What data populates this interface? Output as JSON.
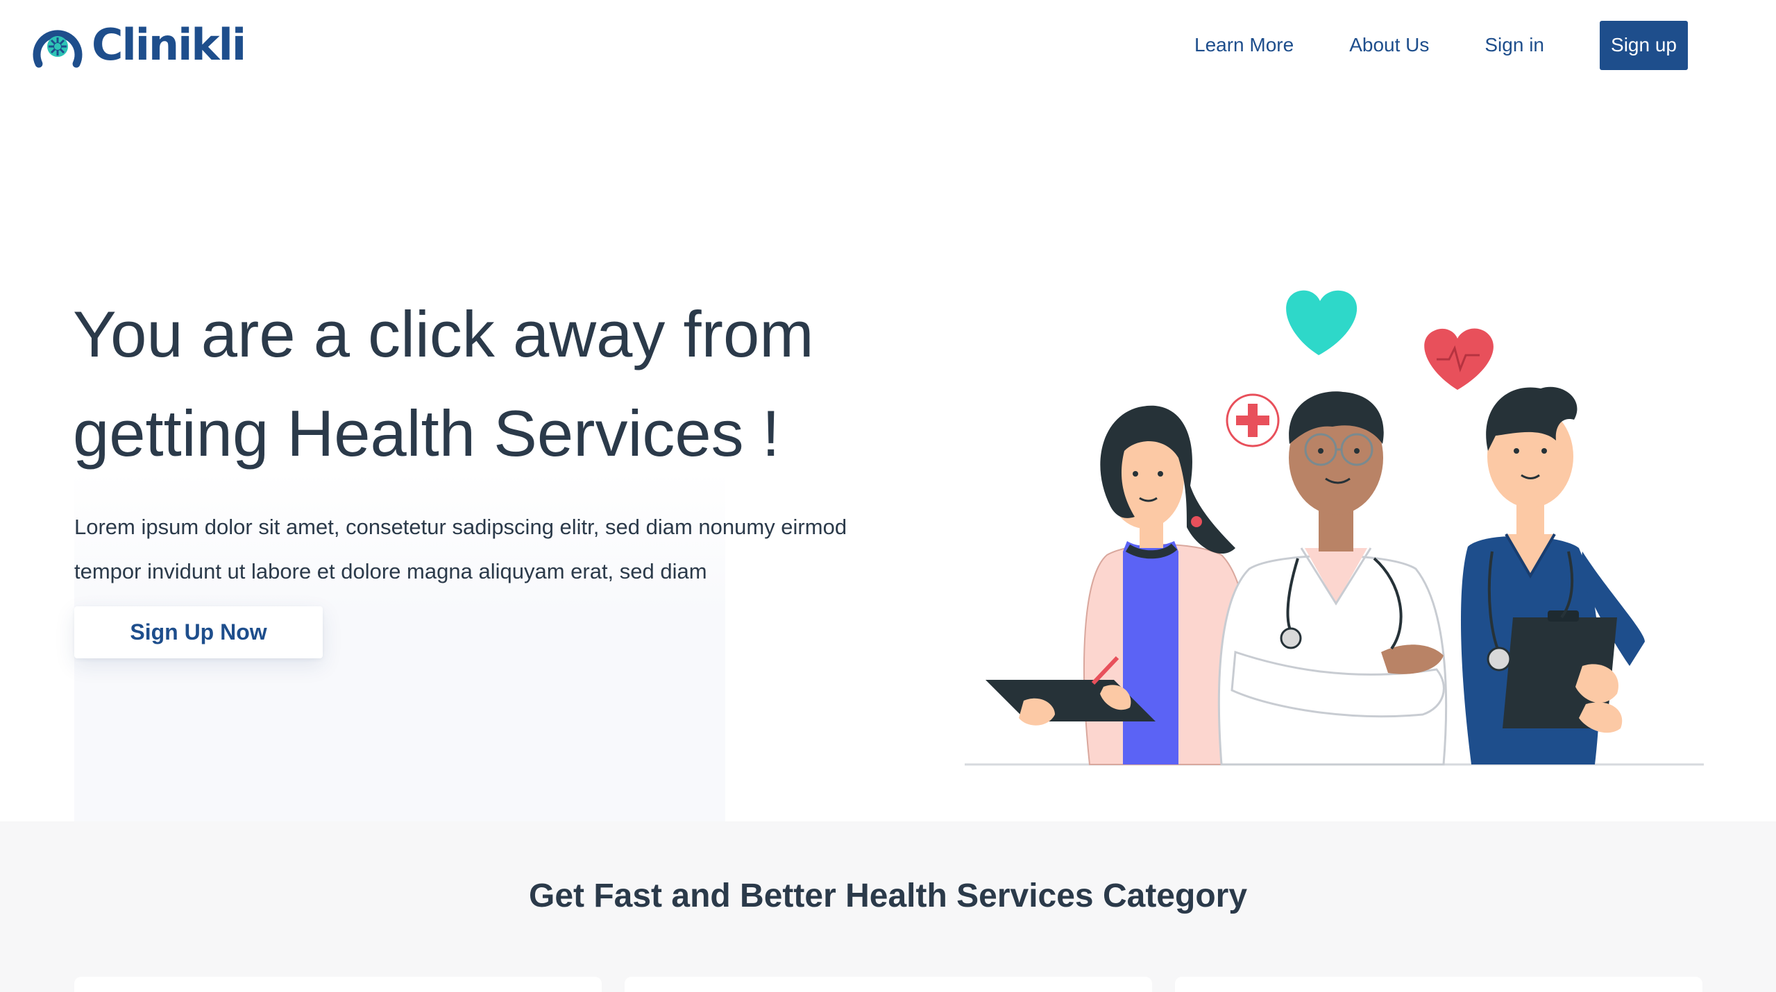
{
  "brand": {
    "name": "Clinikli",
    "color": "#1e4e8c",
    "accent": "#2ec4b6"
  },
  "nav": {
    "links": [
      "Learn More",
      "About Us",
      "Sign in"
    ],
    "signup_label": "Sign up"
  },
  "hero": {
    "title_line1": "You are a click away from",
    "title_line2": "getting Health Services !",
    "desc_line1": "Lorem ipsum dolor sit amet, consetetur sadipscing elitr, sed diam nonumy eirmod",
    "desc_line2": "tempor invidunt ut labore et dolore magna aliquyam erat, sed diam",
    "cta_label": "Sign Up Now"
  },
  "illustration": {
    "icons": [
      "heart-icon",
      "heart-pulse-icon",
      "medical-cross-icon"
    ],
    "colors": {
      "teal_heart": "#2ed8c9",
      "red_heart": "#e8505b",
      "navy": "#1e4e8c",
      "purple": "#5b63f5"
    }
  },
  "category": {
    "title": "Get Fast and Better Health Services Category"
  }
}
